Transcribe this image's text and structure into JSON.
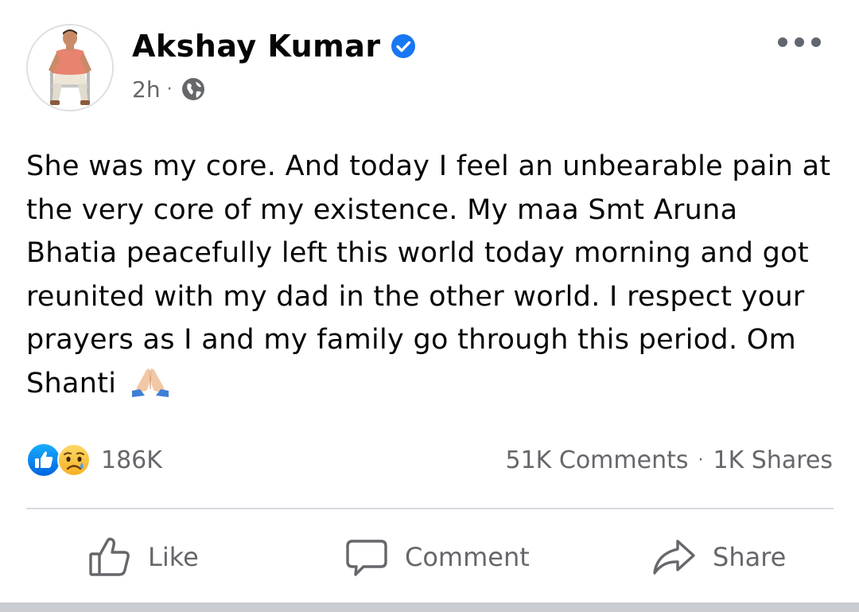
{
  "post": {
    "author": {
      "name": "Akshay Kumar",
      "verified": true,
      "avatar": "profile-photo"
    },
    "meta": {
      "time": "2h",
      "separator": "·",
      "audience_icon": "globe-icon"
    },
    "more_icon": "ellipsis-icon",
    "text": "She was my core. And today I feel an unbearable pain at the very core of my existence. My maa Smt Aruna Bhatia peacefully left this world today morning and got reunited with my dad in the other world. I respect your prayers as I and my family go through this period. Om Shanti",
    "text_emoji": "folded-hands-icon",
    "reactions": {
      "icons": [
        "like-reaction-icon",
        "sad-reaction-icon"
      ],
      "count": "186K"
    },
    "stats": {
      "comments": "51K Comments",
      "separator": "·",
      "shares": "1K Shares"
    },
    "actions": {
      "like": "Like",
      "comment": "Comment",
      "share": "Share"
    }
  },
  "colors": {
    "text": "#050505",
    "secondary": "#65676b",
    "facebook_blue": "#1877f2",
    "sad_yellow": "#f7b125",
    "divider": "#d7dadf"
  }
}
